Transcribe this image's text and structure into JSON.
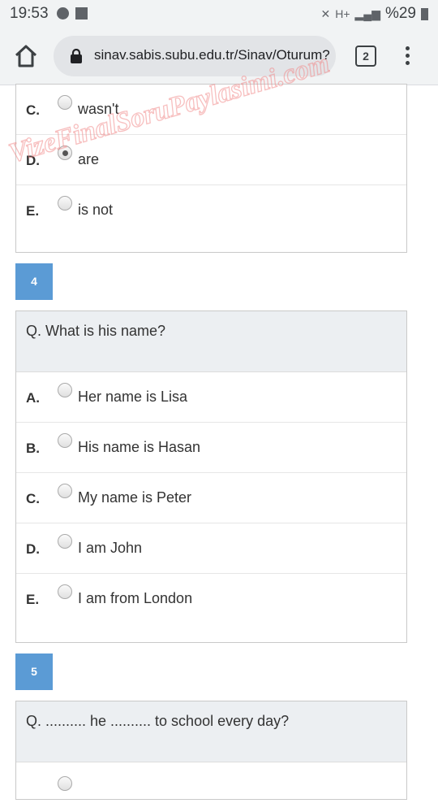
{
  "status_bar": {
    "time": "19:53",
    "battery": "%29",
    "network": "H+"
  },
  "browser": {
    "url": "sinav.sabis.subu.edu.tr/Sinav/Oturum?",
    "tab_count": "2"
  },
  "watermark": "VizeFinalSoruPaylasimi.com",
  "question3": {
    "options": [
      {
        "letter": "C.",
        "text": "wasn't",
        "checked": false
      },
      {
        "letter": "D.",
        "text": "are",
        "checked": true
      },
      {
        "letter": "E.",
        "text": "is not",
        "checked": false
      }
    ]
  },
  "question4": {
    "number": "4",
    "text": "Q. What is his name?",
    "options": [
      {
        "letter": "A.",
        "text": "Her name is Lisa"
      },
      {
        "letter": "B.",
        "text": "His name is Hasan"
      },
      {
        "letter": "C.",
        "text": "My name is Peter"
      },
      {
        "letter": "D.",
        "text": "I am John"
      },
      {
        "letter": "E.",
        "text": "I am from London"
      }
    ]
  },
  "question5": {
    "number": "5",
    "text": "Q. .......... he .......... to school every day?"
  }
}
